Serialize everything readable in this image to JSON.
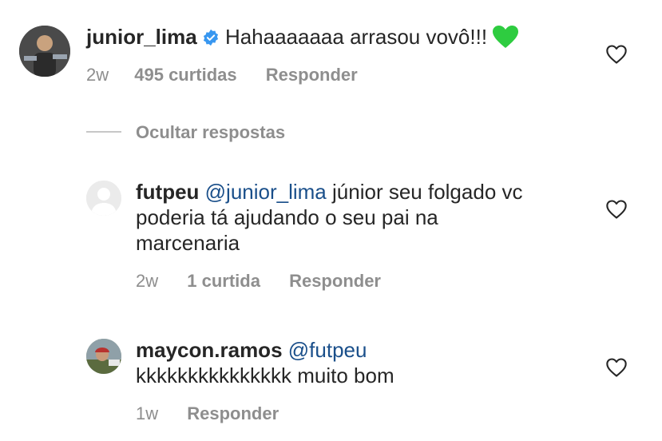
{
  "comment": {
    "username": "junior_lima",
    "text": "Hahaaaaaaa arrasou vovô!!!",
    "time": "2w",
    "likes": "495 curtidas",
    "reply": "Responder"
  },
  "hide_replies": "Ocultar respostas",
  "replies": [
    {
      "username": "futpeu",
      "mention": "@junior_lima",
      "text_line1": "júnior seu folgado vc",
      "text_line2": "poderia tá ajudando o seu pai na",
      "text_line3": "marcenaria",
      "time": "2w",
      "likes": "1 curtida",
      "reply": "Responder"
    },
    {
      "username": "maycon.ramos",
      "mention": "@futpeu",
      "text": "kkkkkkkkkkkkkkk muito bom",
      "time": "1w",
      "reply": "Responder"
    }
  ],
  "colors": {
    "verified": "#3897f0",
    "mention": "#1a4f8a",
    "meta": "#8e8e8e",
    "heart_emoji": "#2ecc40"
  },
  "icons": {
    "verified": "verified-badge-icon",
    "heart": "heart-outline-icon",
    "emoji": "green-heart-emoji"
  }
}
